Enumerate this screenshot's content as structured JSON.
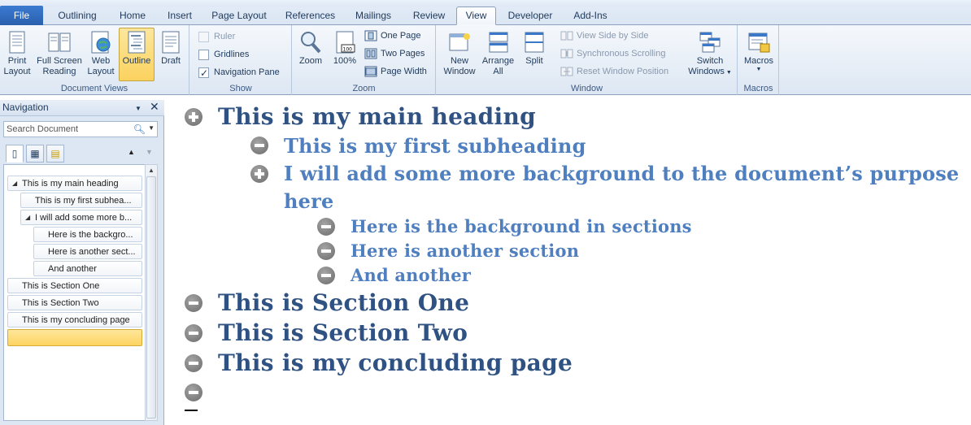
{
  "tabs": [
    "File",
    "Outlining",
    "Home",
    "Insert",
    "Page Layout",
    "References",
    "Mailings",
    "Review",
    "View",
    "Developer",
    "Add-Ins"
  ],
  "active_tab": "View",
  "ribbon": {
    "document_views": {
      "label": "Document Views",
      "print_layout": "Print Layout",
      "full_screen_reading": "Full Screen Reading",
      "web_layout": "Web Layout",
      "outline": "Outline",
      "draft": "Draft"
    },
    "show": {
      "label": "Show",
      "ruler": "Ruler",
      "gridlines": "Gridlines",
      "navigation_pane": "Navigation Pane"
    },
    "zoom": {
      "label": "Zoom",
      "zoom": "Zoom",
      "hundred": "100%",
      "one_page": "One Page",
      "two_pages": "Two Pages",
      "page_width": "Page Width"
    },
    "window": {
      "label": "Window",
      "new_window": "New Window",
      "arrange_all": "Arrange All",
      "split": "Split",
      "view_side_by_side": "View Side by Side",
      "synchronous_scrolling": "Synchronous Scrolling",
      "reset_window_position": "Reset Window Position",
      "switch_windows": "Switch Windows"
    },
    "macros": {
      "label": "Macros",
      "macros": "Macros"
    }
  },
  "navigation": {
    "title": "Navigation",
    "search_placeholder": "Search Document",
    "items": [
      "This is my main heading",
      "This is my first subhea...",
      "I will add some more b...",
      "Here is the backgro...",
      "Here is another sect...",
      "And another",
      "This is Section One",
      "This is Section Two",
      "This is my concluding page"
    ]
  },
  "document": {
    "h1_main": "This is my main heading",
    "h2_first": "This is my first subheading",
    "h2_background_line1": "I will add some more background to the document’s purpose",
    "h2_background_line2": "here",
    "h3_background": "Here is the background in sections",
    "h3_another_section": "Here is another section",
    "h3_and_another": "And another",
    "h1_section_one": "This is Section One",
    "h1_section_two": "This is Section Two",
    "h1_concluding": "This is my concluding page"
  }
}
